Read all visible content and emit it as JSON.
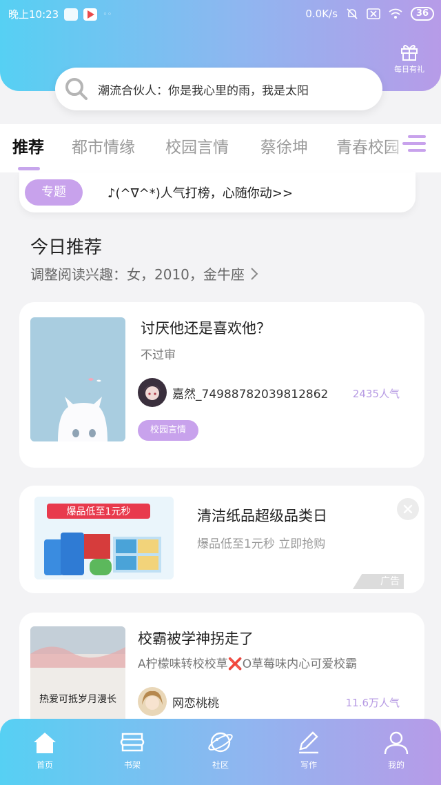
{
  "status_bar": {
    "time": "晚上10:23",
    "net_speed": "0.0K/s",
    "battery": "36"
  },
  "header": {
    "gift_label": "每日有礼",
    "search_placeholder": "潮流合伙人：你是我心里的雨，我是太阳"
  },
  "tabs": [
    {
      "label": "推荐",
      "active": true
    },
    {
      "label": "都市情缘",
      "active": false
    },
    {
      "label": "校园言情",
      "active": false
    },
    {
      "label": "蔡徐坤",
      "active": false
    },
    {
      "label": "青春校园",
      "active": false
    }
  ],
  "topic": {
    "pill": "专题",
    "text": "♪(^∇^*)人气打榜，心随你动>>"
  },
  "section": {
    "title": "今日推荐",
    "subtitle": "调整阅读兴趣：女，2010，金牛座"
  },
  "books": [
    {
      "title": "讨厌他还是喜欢他？",
      "desc": "不过审",
      "author": "嘉然_7498878203981286​2",
      "popularity": "2435人气",
      "tag": "校园言情"
    },
    {
      "title": "校霸被学神拐走了",
      "desc": "A柠檬味转校校草❌O草莓味内心可爱校霸",
      "author": "网恋桃桃",
      "popularity": "11.6万人气",
      "cover_text": "热爱可抵岁月漫长"
    }
  ],
  "ad": {
    "title": "清洁纸品超级品类日",
    "subtitle": "爆品低至1元秒 立即抢购",
    "badge": "广告",
    "banner_text": "爆品低至1元秒"
  },
  "bottom_nav": [
    {
      "label": "首页",
      "icon": "home-icon"
    },
    {
      "label": "书架",
      "icon": "bookshelf-icon"
    },
    {
      "label": "社区",
      "icon": "planet-icon"
    },
    {
      "label": "写作",
      "icon": "pen-icon"
    },
    {
      "label": "我的",
      "icon": "user-icon"
    }
  ],
  "colors": {
    "accent_purple": "#c8a2ec",
    "gradient_start": "#56d0f3",
    "gradient_end": "#b79be8"
  }
}
